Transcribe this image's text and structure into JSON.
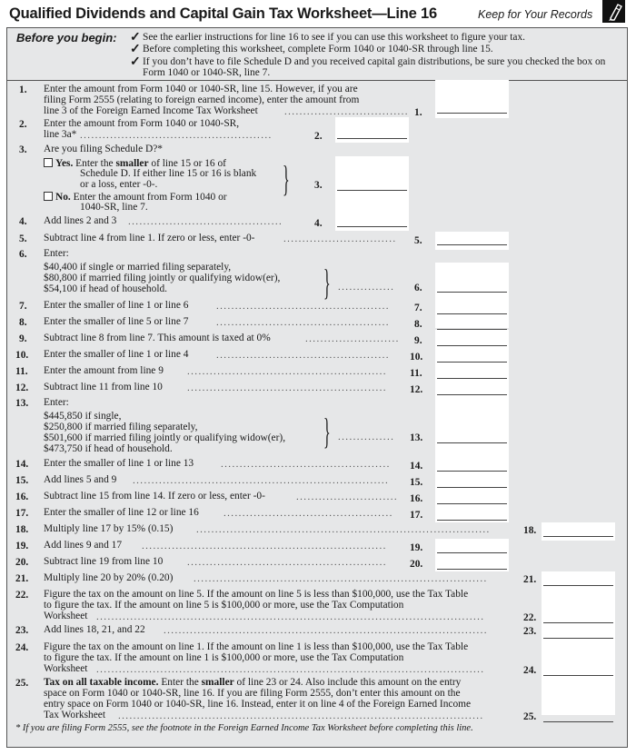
{
  "header": {
    "title": "Qualified Dividends and Capital Gain Tax Worksheet—Line 16",
    "keep_records": "Keep for Your Records",
    "icon": "pencil-icon"
  },
  "before_you_begin": {
    "label": "Before you begin:",
    "items": [
      "See the earlier instructions for line 16 to see if you can use this worksheet to figure your tax.",
      "Before completing this worksheet, complete Form 1040 or 1040-SR through line 15.",
      "If you don’t have to file Schedule D and you received capital gain distributions, be sure you checked the box on Form 1040 or 1040-SR, line 7."
    ]
  },
  "lines": {
    "l1": {
      "num": "1.",
      "text": [
        "Enter the amount from Form 1040 or 1040-SR, line 15. However, if you are",
        "filing Form 2555 (relating to foreign earned income), enter the amount from",
        "line 3 of the Foreign Earned Income Tax Worksheet"
      ],
      "label": "1.",
      "value": ""
    },
    "l2": {
      "num": "2.",
      "text": [
        "Enter the amount from Form 1040 or 1040-SR,",
        "line 3a*"
      ],
      "label": "2.",
      "value": ""
    },
    "l3": {
      "num": "3.",
      "text": "Are you filing Schedule D?*",
      "yes_label": "Yes.",
      "yes_text": [
        "Enter the",
        "smaller",
        "of line 15 or 16 of",
        "Schedule D. If either line 15 or 16 is blank",
        "or a loss, enter -0-."
      ],
      "no_label": "No.",
      "no_text": [
        "Enter the amount from Form 1040 or",
        "1040-SR, line 7."
      ],
      "label": "3.",
      "value": "",
      "yes_checked": false,
      "no_checked": false
    },
    "l4": {
      "num": "4.",
      "text": "Add lines 2 and 3",
      "label": "4.",
      "value": ""
    },
    "l5": {
      "num": "5.",
      "text": "Subtract line 4 from line 1. If zero or less, enter -0-",
      "label": "5.",
      "value": ""
    },
    "l6": {
      "num": "6.",
      "text": [
        "Enter:",
        "$40,400 if single or married filing separately,",
        "$80,800 if married filing jointly or qualifying widow(er),",
        "$54,100 if head of household."
      ],
      "label": "6.",
      "value": ""
    },
    "l7": {
      "num": "7.",
      "text": "Enter the smaller of line 1 or line 6",
      "label": "7.",
      "value": ""
    },
    "l8": {
      "num": "8.",
      "text": "Enter the smaller of line 5 or line 7",
      "label": "8.",
      "value": ""
    },
    "l9": {
      "num": "9.",
      "text": "Subtract line 8 from line 7. This amount is taxed at 0%",
      "label": "9.",
      "value": ""
    },
    "l10": {
      "num": "10.",
      "text": "Enter the smaller of line 1 or line 4",
      "label": "10.",
      "value": ""
    },
    "l11": {
      "num": "11.",
      "text": "Enter the amount from line 9",
      "label": "11.",
      "value": ""
    },
    "l12": {
      "num": "12.",
      "text": "Subtract line 11 from line 10",
      "label": "12.",
      "value": ""
    },
    "l13": {
      "num": "13.",
      "text": [
        "Enter:",
        "$445,850 if single,",
        "$250,800 if married filing separately,",
        "$501,600 if married filing jointly or qualifying widow(er),",
        "$473,750 if head of household."
      ],
      "label": "13.",
      "value": ""
    },
    "l14": {
      "num": "14.",
      "text": "Enter the smaller of line 1 or line 13",
      "label": "14.",
      "value": ""
    },
    "l15": {
      "num": "15.",
      "text": "Add lines 5 and 9",
      "label": "15.",
      "value": ""
    },
    "l16": {
      "num": "16.",
      "text": "Subtract line 15 from line 14. If zero or less, enter -0-",
      "label": "16.",
      "value": ""
    },
    "l17": {
      "num": "17.",
      "text": "Enter the smaller of line 12 or line 16",
      "label": "17.",
      "value": ""
    },
    "l18": {
      "num": "18.",
      "text": "Multiply line 17 by 15% (0.15)",
      "label": "18.",
      "value": ""
    },
    "l19": {
      "num": "19.",
      "text": "Add lines 9 and 17",
      "label": "19.",
      "value": ""
    },
    "l20": {
      "num": "20.",
      "text": "Subtract line 19 from line 10",
      "label": "20.",
      "value": ""
    },
    "l21": {
      "num": "21.",
      "text": "Multiply line 20 by 20% (0.20)",
      "label": "21.",
      "value": ""
    },
    "l22": {
      "num": "22.",
      "text": [
        "Figure the tax on the amount on line 5. If the amount on line 5 is less than $100,000, use the Tax Table",
        "to figure the tax. If the amount on line 5 is $100,000 or more, use the Tax Computation",
        "Worksheet"
      ],
      "label": "22.",
      "value": ""
    },
    "l23": {
      "num": "23.",
      "text": "Add lines 18, 21, and 22",
      "label": "23.",
      "value": ""
    },
    "l24": {
      "num": "24.",
      "text": [
        "Figure the tax on the amount on line 1. If the amount on line 1 is less than $100,000, use the Tax Table",
        "to figure the tax. If the amount on line 1 is $100,000 or more, use the Tax Computation",
        "Worksheet"
      ],
      "label": "24.",
      "value": ""
    },
    "l25": {
      "num": "25.",
      "bold_lead": "Tax on all taxable income.",
      "text": [
        "Enter the",
        "smaller",
        "of line 23 or 24. Also include this amount on the entry",
        "space on Form 1040 or 1040-SR, line 16. If you are filing Form 2555, don’t enter this amount on the",
        "entry space on Form 1040 or 1040-SR, line 16. Instead, enter it on line 4 of the Foreign Earned Income",
        "Tax Worksheet"
      ],
      "label": "25.",
      "value": ""
    }
  },
  "footnote": "* If you are filing Form 2555, see the footnote in the Foreign Earned Income Tax Worksheet before completing this line."
}
